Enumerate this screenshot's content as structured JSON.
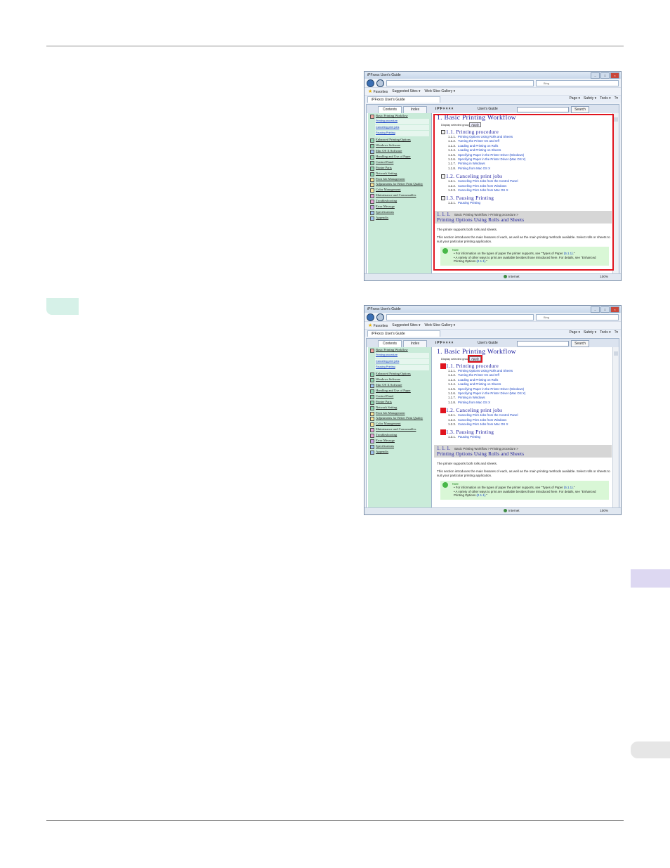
{
  "window": {
    "title": "iPFxxxx User's Guide",
    "tab_title": "iPFxxxx User's Guide",
    "search_placeholder": "Bing",
    "favorites_label": "Favorites",
    "suggested_sites": "Suggested Sites ▾",
    "web_slice_gallery": "Web Slice Gallery ▾",
    "toolbar": [
      "Page ▾",
      "Safety ▾",
      "Tools ▾",
      "?▾"
    ]
  },
  "app": {
    "tab_contents": "Contents",
    "tab_index": "Index",
    "brand": "iPF××××",
    "guide": "User's Guide",
    "search_button": "Search"
  },
  "toc": {
    "items": [
      "Basic Printing Workflow",
      "Enhanced Printing Options",
      "Windows Software",
      "Mac OS X Software",
      "Handling and Use of Paper",
      "Control Panel",
      "Printer Parts",
      "Network Setting",
      "Print Job Management",
      "Adjustments for Better Print Quality",
      "Color Management",
      "Maintenance and Consumables",
      "Troubleshooting",
      "Error Message",
      "Specifications",
      "Appendix"
    ],
    "subitems": [
      "Printing procedure",
      "Canceling print jobs",
      "Pausing Printing"
    ]
  },
  "content": {
    "h1": "1. Basic Printing Workflow",
    "display_selected": "Display selected group",
    "apply": "Apply",
    "sections": [
      {
        "title": "1.1. Printing procedure",
        "items": [
          {
            "num": "1.1.1.",
            "label": "Printing Options Using Rolls and Sheets"
          },
          {
            "num": "1.1.2.",
            "label": "Turning the Printer On and Off"
          },
          {
            "num": "1.1.3.",
            "label": "Loading and Printing on Rolls"
          },
          {
            "num": "1.1.4.",
            "label": "Loading and Printing on Sheets"
          },
          {
            "num": "1.1.5.",
            "label": "Specifying Paper in the Printer Driver (Windows)"
          },
          {
            "num": "1.1.6.",
            "label": "Specifying Paper in the Printer Driver (Mac OS X)"
          },
          {
            "num": "1.1.7.",
            "label": "Printing in Windows"
          },
          {
            "num": "1.1.8.",
            "label": "Printing from Mac OS X"
          }
        ]
      },
      {
        "title": "1.2. Canceling print jobs",
        "items": [
          {
            "num": "1.2.1.",
            "label": "Canceling Print Jobs from the Control Panel"
          },
          {
            "num": "1.2.2.",
            "label": "Canceling Print Jobs from Windows"
          },
          {
            "num": "1.2.3.",
            "label": "Canceling Print Jobs from Mac OS X"
          }
        ]
      },
      {
        "title": "1.3. Pausing Printing",
        "items": [
          {
            "num": "1.3.1.",
            "label": "Pausing Printing"
          }
        ]
      }
    ],
    "band_num": "1. 1. 1.",
    "band_path": "Basic Printing Workflow > Printing procedure >",
    "band_title": "Printing Options Using Rolls and Sheets",
    "para1": "The printer supports both rolls and sheets.",
    "para2": "This section introduces the main features of each, as well as the main printing methods available. Select rolls or sheets to suit your particular printing application.",
    "note_label": "Note",
    "note1_text": "For information on the types of paper the printer supports, see \"Types of Paper ",
    "note1_link": "(5.1.1)",
    "note1_end": ".\"",
    "note2_text": "A variety of other ways to print are available besides those introduced here. For details, see \"Enhanced Printing Options ",
    "note2_link": "(2.1.1)",
    "note2_end": ".\""
  },
  "status": {
    "zone": "Internet",
    "zoom": "100%"
  }
}
